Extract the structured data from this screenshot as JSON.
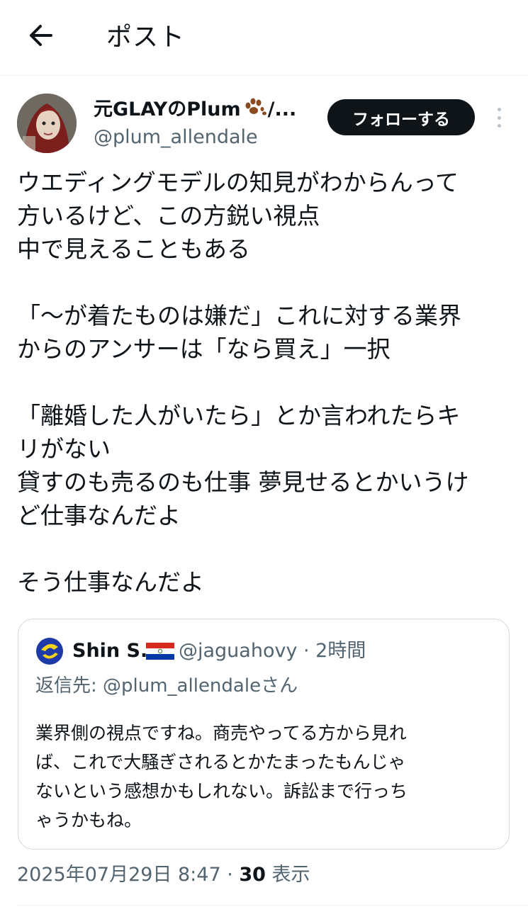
{
  "header": {
    "title": "ポスト",
    "back_icon": "arrow-left-icon"
  },
  "author": {
    "display_name": "元GLAYのPlum",
    "name_suffix": "/...",
    "handle": "@plum_allendale",
    "follow_label": "フォローする",
    "more_icon": "vertical-dots-icon"
  },
  "post": {
    "lines": [
      "ウエディングモデルの知見がわからんって",
      "方いるけど、この方鋭い視点",
      "中で見えることもある",
      "",
      "「～が着たものは嫌だ」これに対する業界",
      "からのアンサーは「なら買え」一択",
      "",
      "「離婚した人がいたら」とか言われたらキ",
      "リがない",
      "貸すのも売るのも仕事 夢見せるとかいうけ",
      "ど仕事なんだよ",
      "",
      "そう仕事なんだよ"
    ]
  },
  "quote": {
    "name": "Shin S.",
    "meta": "@jaguahovy · 2時間",
    "reply_to": "返信先: @plum_allendaleさん",
    "lines": [
      "業界側の視点ですね。商売やってる方から見れ",
      "ば、これで大騒ぎされるとかたまったもんじゃ",
      "ないという感想かもしれない。訴訟まで行っち",
      "ゃうかもね。"
    ]
  },
  "footer": {
    "datetime": "2025年07月29日 8:47 · ",
    "views_count": "30",
    "views_label": " 表示"
  },
  "colors": {
    "text": "#0f1419",
    "secondary": "#536471",
    "border": "#cfd9de",
    "button": "#0f1419"
  }
}
